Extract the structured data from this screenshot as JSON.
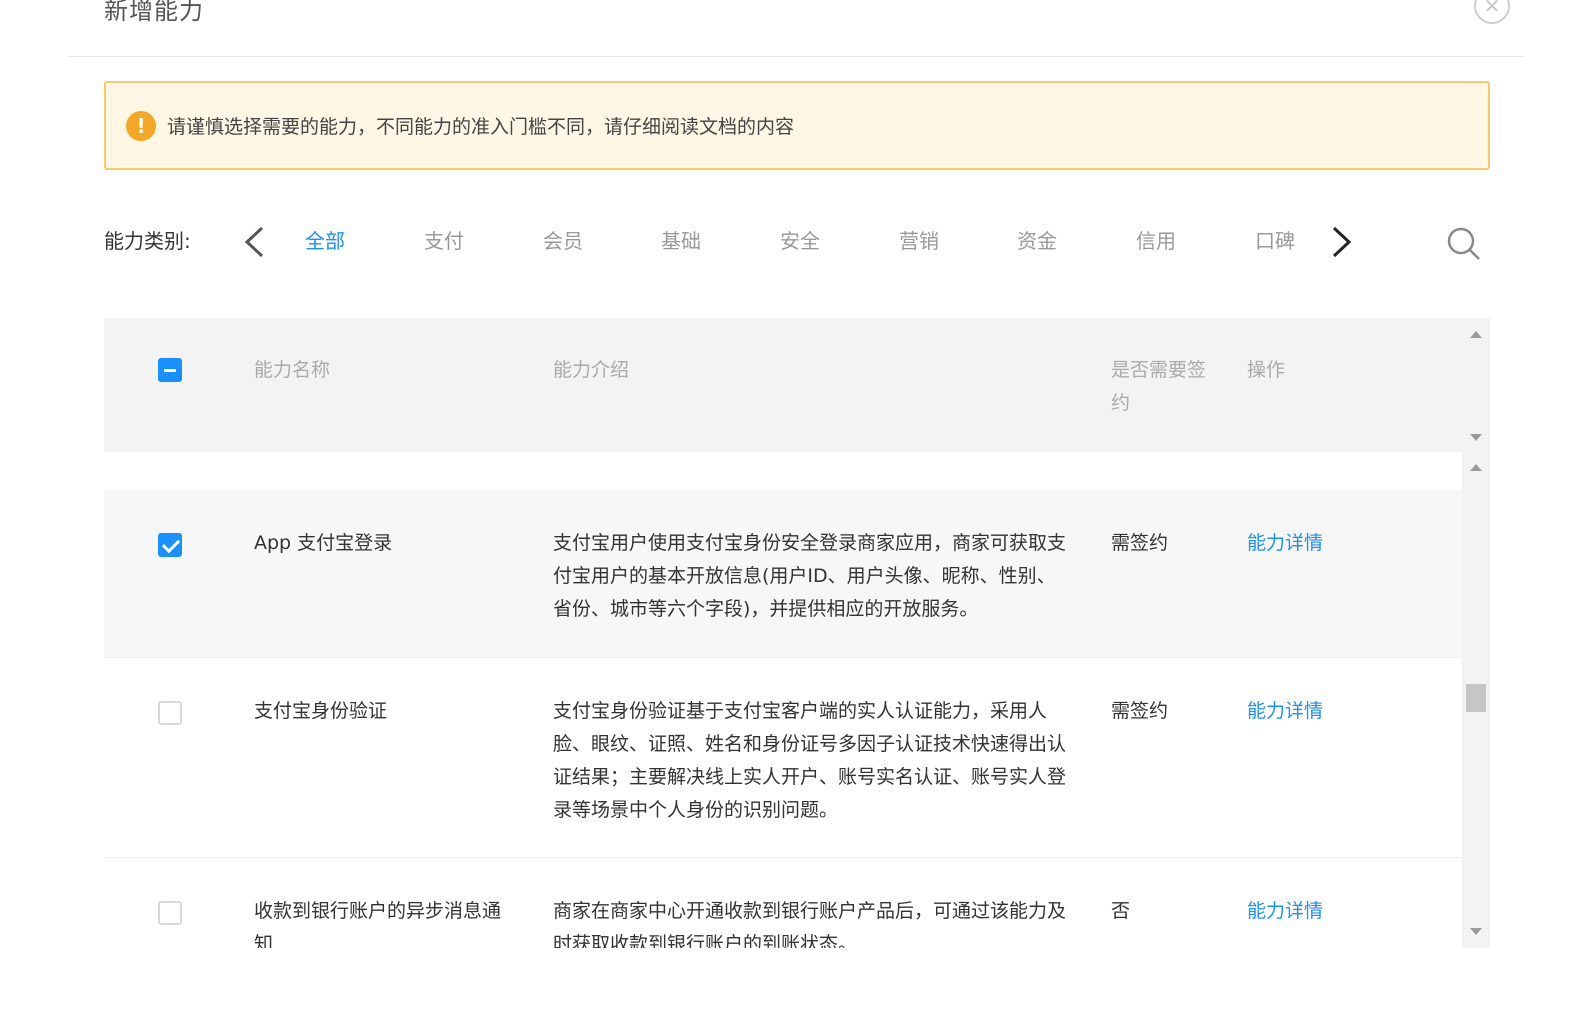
{
  "dialog": {
    "title": "新增能力",
    "close_label": "✕"
  },
  "alert": {
    "icon_text": "!",
    "text": "请谨慎选择需要的能力，不同能力的准入门槛不同，请仔细阅读文档的内容"
  },
  "category": {
    "label": "能力类别:",
    "tabs": [
      "全部",
      "支付",
      "会员",
      "基础",
      "安全",
      "营销",
      "资金",
      "信用",
      "口碑"
    ],
    "active_index": 0
  },
  "table": {
    "headers": {
      "name": "能力名称",
      "desc": "能力介绍",
      "sign": "是否需要签约",
      "op": "操作"
    },
    "header_checkbox_state": "indeterminate",
    "rows": [
      {
        "checked": true,
        "name": "App 支付宝登录",
        "desc": "支付宝用户使用支付宝身份安全登录商家应用，商家可获取支付宝用户的基本开放信息(用户ID、用户头像、昵称、性别、省份、城市等六个字段)，并提供相应的开放服务。",
        "sign": "需签约",
        "op": "能力详情"
      },
      {
        "checked": false,
        "name": "支付宝身份验证",
        "desc": "支付宝身份验证基于支付宝客户端的实人认证能力，采用人脸、眼纹、证照、姓名和身份证号多因子认证技术快速得出认证结果；主要解决线上实人开户、账号实名认证、账号实人登录等场景中个人身份的识别问题。",
        "sign": "需签约",
        "op": "能力详情"
      },
      {
        "checked": false,
        "name": "收款到银行账户的异步消息通知",
        "desc": "商家在商家中心开通收款到银行账户产品后，可通过该能力及时获取收款到银行账户的到账状态。",
        "sign": "否",
        "op": "能力详情"
      }
    ]
  },
  "colors": {
    "accent": "#1890ff",
    "warning_bg": "#fff7e6",
    "warning_border": "#fbc86a",
    "warning_icon": "#f5a623"
  }
}
